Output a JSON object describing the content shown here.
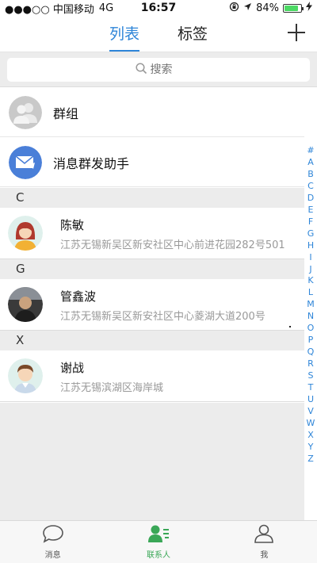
{
  "status_bar": {
    "carrier": "●●●○○ 中国移动",
    "network": "4G",
    "time": "16:57",
    "battery_text": "84%",
    "battery_level": 0.84
  },
  "nav": {
    "tabs": [
      {
        "label": "列表",
        "active": true
      },
      {
        "label": "标签",
        "active": false
      }
    ],
    "add_icon": "plus-icon"
  },
  "search": {
    "placeholder": "搜索"
  },
  "special_rows": [
    {
      "label": "群组",
      "icon": "group-avatar-icon"
    },
    {
      "label": "消息群发助手",
      "icon": "mail-icon"
    }
  ],
  "sections": [
    {
      "letter": "C",
      "contacts": [
        {
          "name": "陈敏",
          "address": "江苏无锡新吴区新安社区中心前进花园282号501"
        }
      ]
    },
    {
      "letter": "G",
      "contacts": [
        {
          "name": "管鑫波",
          "address": "江苏无锡新吴区新安社区中心菱湖大道200号"
        }
      ]
    },
    {
      "letter": "X",
      "contacts": [
        {
          "name": "谢战",
          "address": "江苏无锡滨湖区海岸城"
        }
      ]
    }
  ],
  "index_letters": [
    "#",
    "A",
    "B",
    "C",
    "D",
    "E",
    "F",
    "G",
    "H",
    "I",
    "J",
    "K",
    "L",
    "M",
    "N",
    "O",
    "P",
    "Q",
    "R",
    "S",
    "T",
    "U",
    "V",
    "W",
    "X",
    "Y",
    "Z"
  ],
  "tabbar": [
    {
      "label": "消息",
      "icon": "chat-bubble-icon",
      "active": false
    },
    {
      "label": "联系人",
      "icon": "contacts-icon",
      "active": true
    },
    {
      "label": "我",
      "icon": "person-icon",
      "active": false
    }
  ],
  "colors": {
    "accent": "#2e85d8",
    "active_tab": "#3aa757",
    "section_bg": "#ececec"
  }
}
